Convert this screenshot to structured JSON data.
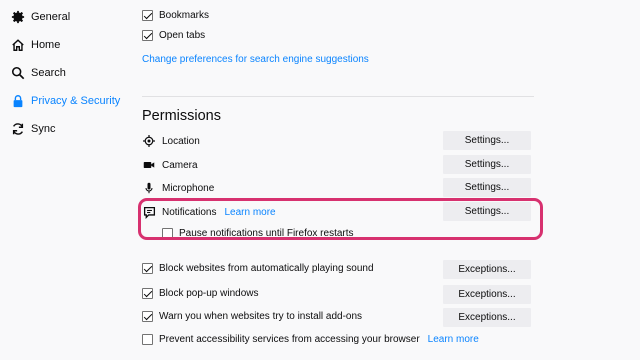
{
  "sidebar": {
    "items": [
      {
        "label": "General",
        "icon": "gear-icon"
      },
      {
        "label": "Home",
        "icon": "home-icon"
      },
      {
        "label": "Search",
        "icon": "search-icon"
      },
      {
        "label": "Privacy & Security",
        "icon": "lock-icon",
        "active": true
      },
      {
        "label": "Sync",
        "icon": "sync-icon"
      }
    ]
  },
  "history": {
    "bookmarks_label": "Bookmarks",
    "bookmarks_checked": true,
    "open_tabs_label": "Open tabs",
    "open_tabs_checked": true,
    "change_prefs_link": "Change preferences for search engine suggestions"
  },
  "permissions": {
    "title": "Permissions",
    "rows": [
      {
        "label": "Location",
        "icon": "location-icon",
        "button": "Settings..."
      },
      {
        "label": "Camera",
        "icon": "camera-icon",
        "button": "Settings..."
      },
      {
        "label": "Microphone",
        "icon": "microphone-icon",
        "button": "Settings..."
      },
      {
        "label": "Notifications",
        "icon": "notification-icon",
        "button": "Settings...",
        "link": "Learn more"
      }
    ],
    "pause_notifications_label": "Pause notifications until Firefox restarts",
    "pause_notifications_checked": false,
    "options": [
      {
        "label": "Block websites from automatically playing sound",
        "checked": true,
        "button": "Exceptions..."
      },
      {
        "label": "Block pop-up windows",
        "checked": true,
        "button": "Exceptions..."
      },
      {
        "label": "Warn you when websites try to install add-ons",
        "checked": true,
        "button": "Exceptions..."
      },
      {
        "label": "Prevent accessibility services from accessing your browser",
        "checked": false,
        "link": "Learn more"
      }
    ]
  },
  "colors": {
    "accent": "#0a84ff",
    "highlight": "#d7316f",
    "button_bg": "#ededf0",
    "background": "#f9f9fa"
  }
}
